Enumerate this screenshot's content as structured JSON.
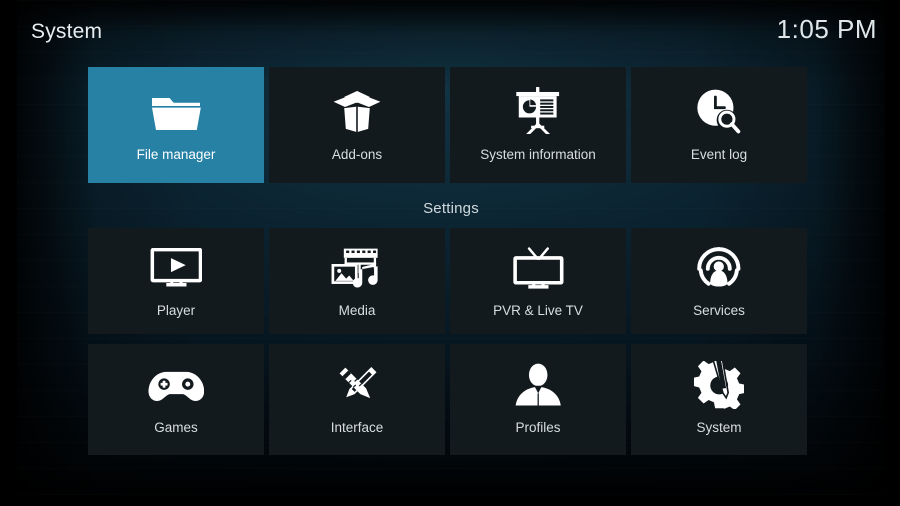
{
  "header": {
    "title": "System",
    "clock": "1:05 PM"
  },
  "section": {
    "settings_label": "Settings"
  },
  "colors": {
    "highlight": "#2681a5",
    "tile": "#121a1e",
    "text": "#d7dee1",
    "text_bright": "#ffffff",
    "background_top": "#0d2b3a",
    "background_bottom": "#01060a"
  },
  "rows": [
    {
      "name": "top-row",
      "tiles": [
        {
          "label": "File manager",
          "icon": "folder-icon",
          "selected": true
        },
        {
          "label": "Add-ons",
          "icon": "open-box-icon",
          "selected": false
        },
        {
          "label": "System information",
          "icon": "presentation-chart-icon",
          "selected": false
        },
        {
          "label": "Event log",
          "icon": "clock-search-icon",
          "selected": false
        }
      ]
    },
    {
      "name": "settings-row-1",
      "tiles": [
        {
          "label": "Player",
          "icon": "monitor-play-icon",
          "selected": false
        },
        {
          "label": "Media",
          "icon": "media-library-icon",
          "selected": false
        },
        {
          "label": "PVR & Live TV",
          "icon": "tv-antenna-icon",
          "selected": false
        },
        {
          "label": "Services",
          "icon": "broadcast-icon",
          "selected": false
        }
      ]
    },
    {
      "name": "settings-row-2",
      "tiles": [
        {
          "label": "Games",
          "icon": "gamepad-icon",
          "selected": false
        },
        {
          "label": "Interface",
          "icon": "pencil-ruler-icon",
          "selected": false
        },
        {
          "label": "Profiles",
          "icon": "person-icon",
          "selected": false
        },
        {
          "label": "System",
          "icon": "gear-screwdriver-icon",
          "selected": false
        }
      ]
    }
  ]
}
